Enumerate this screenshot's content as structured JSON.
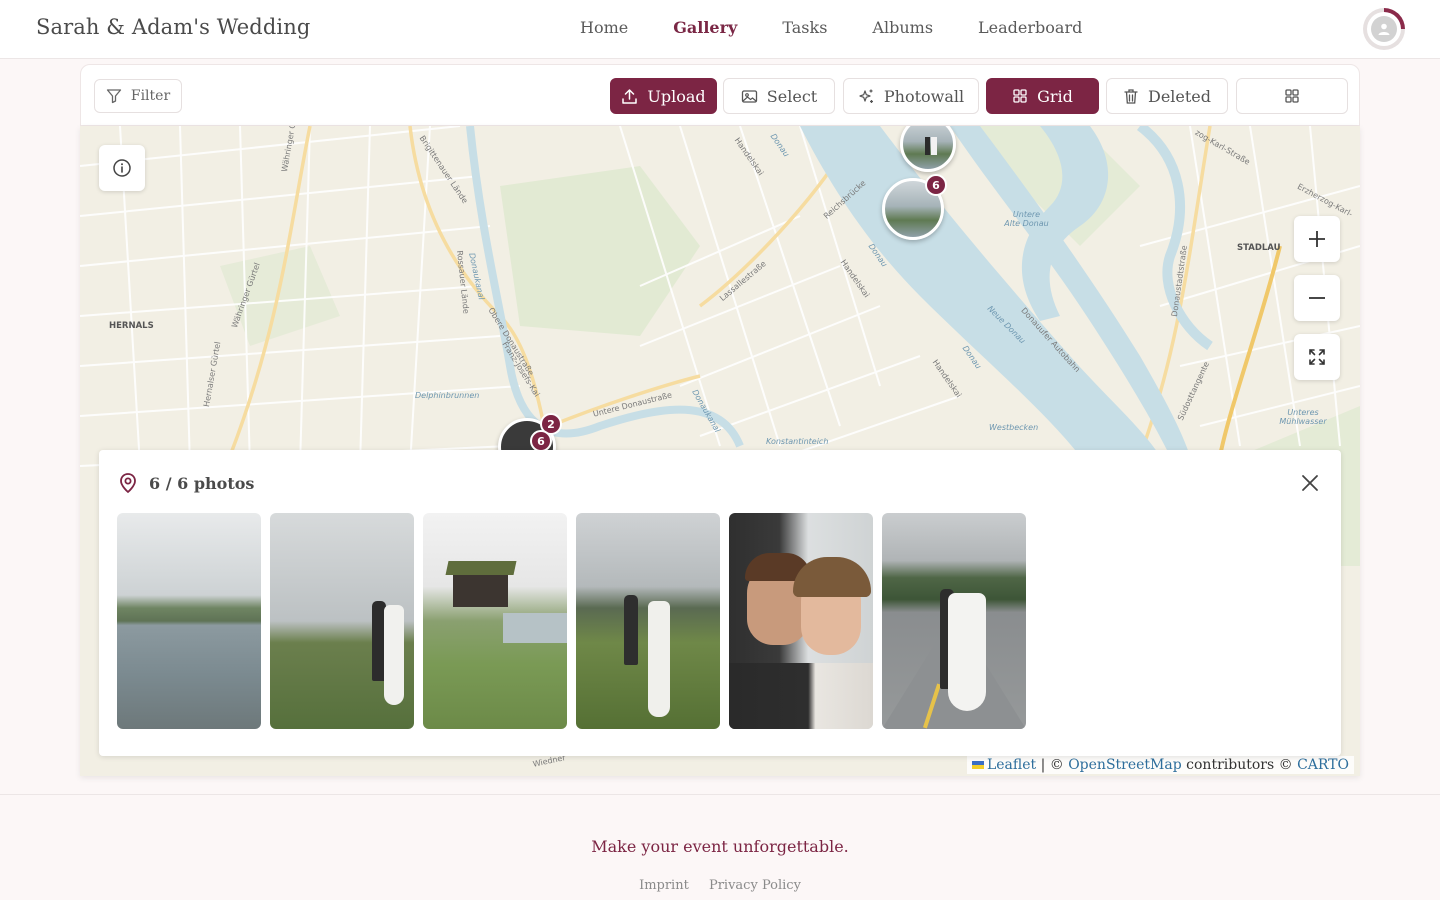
{
  "header": {
    "brand": "Sarah & Adam's Wedding",
    "nav": [
      "Home",
      "Gallery",
      "Tasks",
      "Albums",
      "Leaderboard"
    ],
    "active_nav": "Gallery"
  },
  "toolbar": {
    "filter": "Filter",
    "upload": "Upload",
    "select": "Select",
    "photowall": "Photowall",
    "grid": "Grid",
    "deleted": "Deleted"
  },
  "map": {
    "labels": {
      "hernals": "HERNALS",
      "stadlau": "STADLAU",
      "waehringer1": "Währinger Gürtel",
      "waehringer2": "Währinger Gürtel",
      "hernalser": "Hernalser Gürtel",
      "lassalle": "Lassallestraße",
      "reichsbruecke": "Reichsbrücke",
      "handelskai1": "Handelskai",
      "handelskai2": "Handelskai",
      "handelskai3": "Handelskai",
      "donau1": "Donau",
      "donau2": "Donau",
      "donau3": "Donau",
      "neue_donau": "Neue Donau",
      "untere_alte_donau": "Untere Alte Donau",
      "donauufer": "Donauufer Autobahn",
      "donaustadt": "Donaustadtstraße",
      "suedosttangente": "Südosttangente",
      "untere_donaustrasse": "Untere Donaustraße",
      "obere_donaustrasse": "Obere Donaustraße",
      "franz_josefs_kai": "Franz-Josefs-Kai",
      "rossauer": "Rossauer Lände",
      "donaukanal1": "Donaukanal",
      "donaukanal2": "Donaukanal",
      "brigittenauer": "Brigittenauer Lände",
      "delphinbrunnen": "Delphinbrunnen",
      "konstantinteich": "Konstantinteich",
      "westbecken": "Westbecken",
      "untere_muehlwasser": "Unteres Mühlwasser",
      "erzherzog": "Erzherzog-Karl-",
      "zog_karl": "zog-Karl-Straße",
      "wiedner": "Wiedner"
    },
    "clusters": [
      {
        "count": "6"
      },
      {
        "count": "2"
      },
      {
        "count": "6"
      }
    ],
    "attribution": {
      "leaflet": "Leaflet",
      "osm": "OpenStreetMap",
      "contributors": "contributors ©",
      "carto": "CARTO"
    }
  },
  "panel": {
    "count_text": "6 / 6 photos",
    "photos": [
      "lake-landscape",
      "couple-in-meadow",
      "cabin-by-lake",
      "couple-standing-in-grass",
      "couple-forehead-touch",
      "couple-on-road"
    ]
  },
  "footer": {
    "tagline": "Make your event unforgettable.",
    "imprint": "Imprint",
    "privacy": "Privacy Policy"
  },
  "colors": {
    "accent": "#7c2544",
    "map_bg": "#f2efe4",
    "water": "#c7dee6"
  }
}
